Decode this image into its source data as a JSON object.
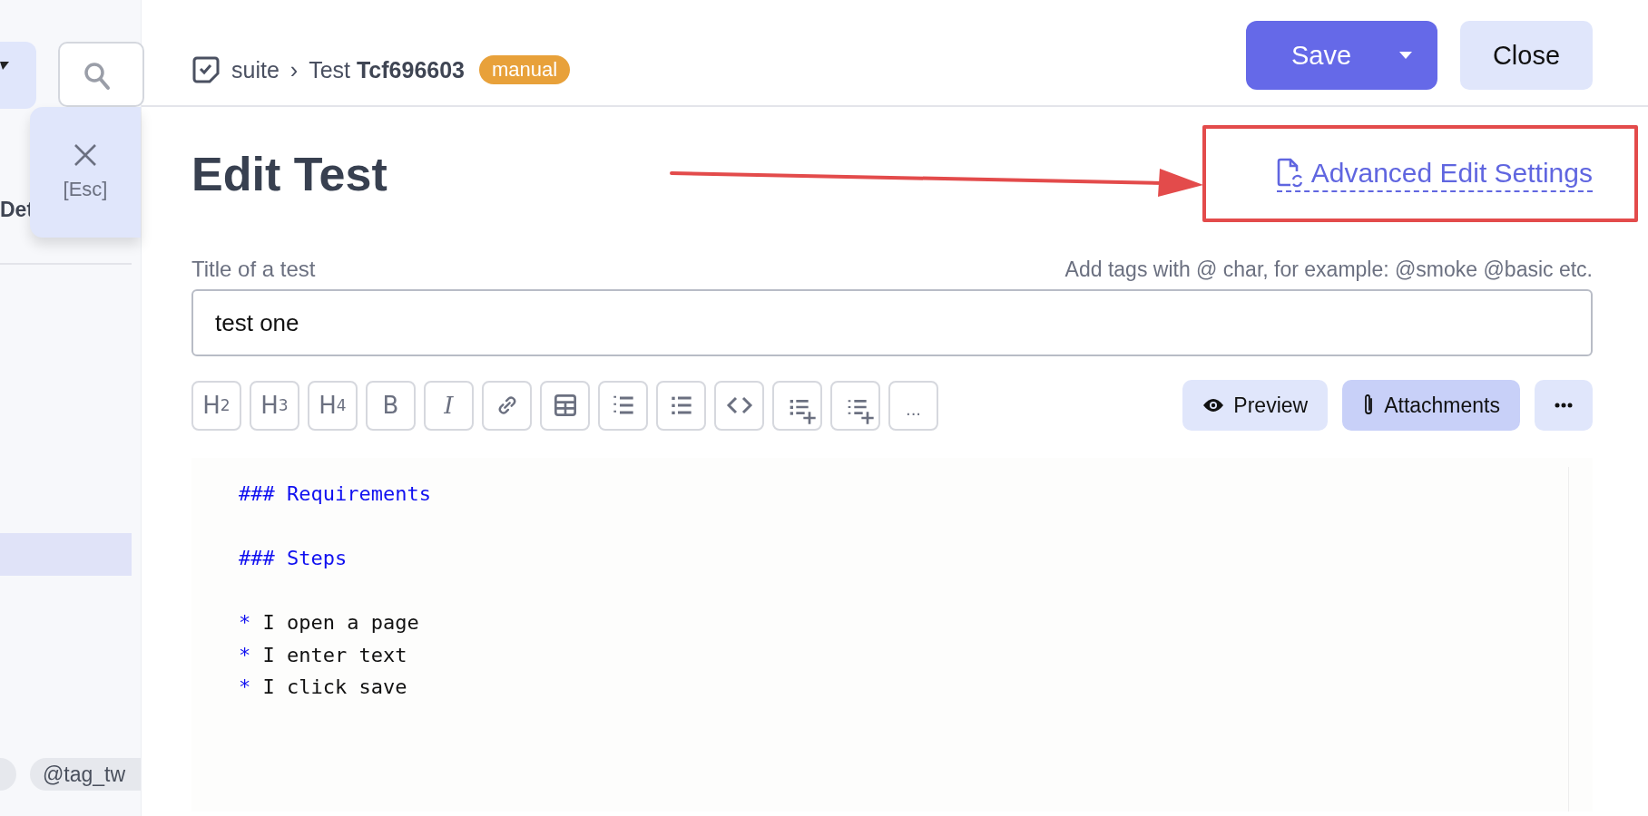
{
  "sidebar": {
    "partial_heading": "Det",
    "esc_button": {
      "label": "[Esc]"
    },
    "tags": [
      {
        "label": "@tag_tw"
      }
    ]
  },
  "header": {
    "breadcrumb": {
      "suite": "suite",
      "separator": "›",
      "test": "Test **Tcf696603**"
    },
    "badge": "manual",
    "save_button": {
      "label": "Save"
    },
    "close_button": {
      "label": "Close"
    }
  },
  "page_title": "Edit Test",
  "advanced_link": "Advanced Edit Settings",
  "title_field": {
    "label": "Title of a test",
    "hint": "Add tags with @ char, for example: @smoke @basic etc.",
    "value": "test one"
  },
  "format_buttons": [
    {
      "kind": "heading",
      "label": "H2"
    },
    {
      "kind": "heading",
      "label": "H3"
    },
    {
      "kind": "heading",
      "label": "H4"
    },
    {
      "kind": "bold",
      "label": "B"
    },
    {
      "kind": "italic",
      "label": "I"
    },
    {
      "kind": "link"
    },
    {
      "kind": "table"
    },
    {
      "kind": "ordered"
    },
    {
      "kind": "bullets"
    },
    {
      "kind": "code"
    },
    {
      "kind": "addbullets"
    },
    {
      "kind": "addordered"
    },
    {
      "kind": "more",
      "label": "..."
    }
  ],
  "view_buttons": [
    {
      "kind": "preview",
      "label": "Preview",
      "selected": false
    },
    {
      "kind": "attachments",
      "label": "Attachments",
      "selected": true
    },
    {
      "kind": "more"
    }
  ],
  "editor": {
    "lines": [
      {
        "kind": "heading",
        "text": "### Requirements"
      },
      {
        "kind": "blank"
      },
      {
        "kind": "heading",
        "text": "### Steps"
      },
      {
        "kind": "blank"
      },
      {
        "kind": "bullet",
        "marker": "*",
        "text": "I open a page"
      },
      {
        "kind": "bullet",
        "marker": "*",
        "text": "I enter text"
      },
      {
        "kind": "bullet",
        "marker": "*",
        "text": "I click save"
      }
    ]
  }
}
